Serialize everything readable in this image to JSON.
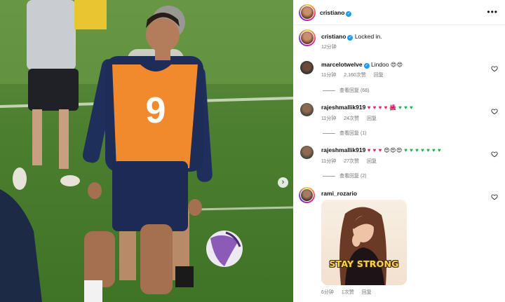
{
  "post": {
    "author": "cristiano",
    "caption": "Locked in.",
    "caption_time": "12分钟",
    "jersey_number": "9"
  },
  "comments": [
    {
      "user": "marcelotwelve",
      "verified": true,
      "text": "Lindoo",
      "emoji": "😍😍",
      "time": "11分钟",
      "likes": "2,160次赞",
      "reply": "回复",
      "view_replies": "查看回复 (68)"
    },
    {
      "user": "rajeshmallik919",
      "verified": false,
      "text": "♥ ♥ ♥ ♥",
      "emoji": "🌺",
      "text2": "♥ ♥ ♥",
      "time": "11分钟",
      "likes": "24次赞",
      "reply": "回复",
      "view_replies": "查看回复 (1)"
    },
    {
      "user": "rajeshmallik919",
      "verified": false,
      "text": "♥ ♥ ♥",
      "emoji": "😍😍😍",
      "text2": "♥ ♥ ♥ ♥ ♥ ♥ ♥",
      "time": "11分钟",
      "likes": "27次赞",
      "reply": "回复",
      "view_replies": "查看回复 (2)"
    },
    {
      "user": "rami_rozario",
      "verified": false,
      "sticker_text": "STAY STRONG",
      "time": "6分钟",
      "likes": "1次赞",
      "reply": "回复"
    }
  ],
  "icons": {
    "more": "more-options-icon",
    "verified": "verified-badge-icon",
    "like": "heart-outline-icon",
    "next": "chevron-right-icon"
  },
  "colors": {
    "verified_blue": "#1d9bf0",
    "bib_orange": "#f08a2c",
    "red_heart": "#e0245e",
    "green_heart": "#19b34a"
  }
}
